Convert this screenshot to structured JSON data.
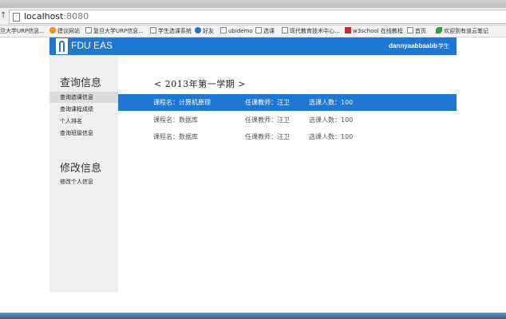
{
  "browser": {
    "nav_glyph": "↑",
    "url_host": "localhost",
    "url_port": ":8080",
    "bookmarks": [
      {
        "label": "旦大学URP信息...",
        "icon": "page-icon"
      },
      {
        "label": "建议网站",
        "icon": "orange-icon"
      },
      {
        "label": "复旦大学URP信息...",
        "icon": "page-icon"
      },
      {
        "label": "学生选课系统",
        "icon": "page-icon"
      },
      {
        "label": "好友",
        "icon": "user-icon"
      },
      {
        "label": "ubidemo",
        "icon": "page-icon"
      },
      {
        "label": "选课",
        "icon": "page-icon"
      },
      {
        "label": "现代教育技术中心...",
        "icon": "page-icon"
      },
      {
        "label": "w3school 在线教程",
        "icon": "w3-icon"
      },
      {
        "label": "首页",
        "icon": "page-icon"
      },
      {
        "label": "欢迎到有道云笔记",
        "icon": "leaf-icon"
      }
    ]
  },
  "header": {
    "title": "FDU EAS",
    "user": "dannyaabbaabb",
    "role": "学生"
  },
  "sidebar": {
    "query_heading": "查询信息",
    "query_items": [
      "查询选课信息",
      "查询课程成绩",
      "个人排名",
      "查询班级信息"
    ],
    "modify_heading": "修改信息",
    "modify_items": [
      "修改个人信息"
    ]
  },
  "main": {
    "term": "< 2013年第一学期 >",
    "courses": [
      {
        "name": "课程名：计算机原理",
        "teacher": "任课教师：汪卫",
        "count": "选课人数：100"
      },
      {
        "name": "课程名：数据库",
        "teacher": "任课教师：汪卫",
        "count": "选课人数：100"
      },
      {
        "name": "课程名：数据库",
        "teacher": "任课教师：汪卫",
        "count": "选课人数：100"
      }
    ]
  },
  "colors": {
    "accent": "#1e77d3",
    "sidebar_bg": "#f0f0f0"
  }
}
